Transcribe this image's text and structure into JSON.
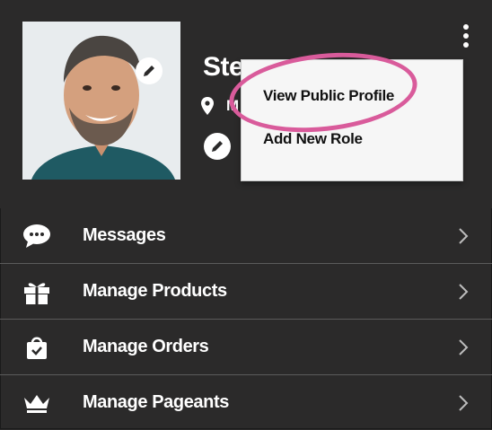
{
  "profile": {
    "name": "Ste",
    "location": "M",
    "avatar_desc": "avatar"
  },
  "menu_button": {
    "icon": "vertical-ellipsis-icon"
  },
  "dropdown": {
    "items": [
      {
        "label": "View Public Profile"
      },
      {
        "label": "Add New Role"
      }
    ]
  },
  "nav": {
    "items": [
      {
        "label": "Messages",
        "icon": "chat-bubble-icon"
      },
      {
        "label": "Manage Products",
        "icon": "gift-box-icon"
      },
      {
        "label": "Manage Orders",
        "icon": "shopping-bag-icon"
      },
      {
        "label": "Manage Pageants",
        "icon": "crown-icon"
      }
    ]
  },
  "colors": {
    "background": "#2b2a2a",
    "divider": "#5b5b5b",
    "highlight": "#d95b9b",
    "dropdown_bg": "#f6f6f6"
  }
}
